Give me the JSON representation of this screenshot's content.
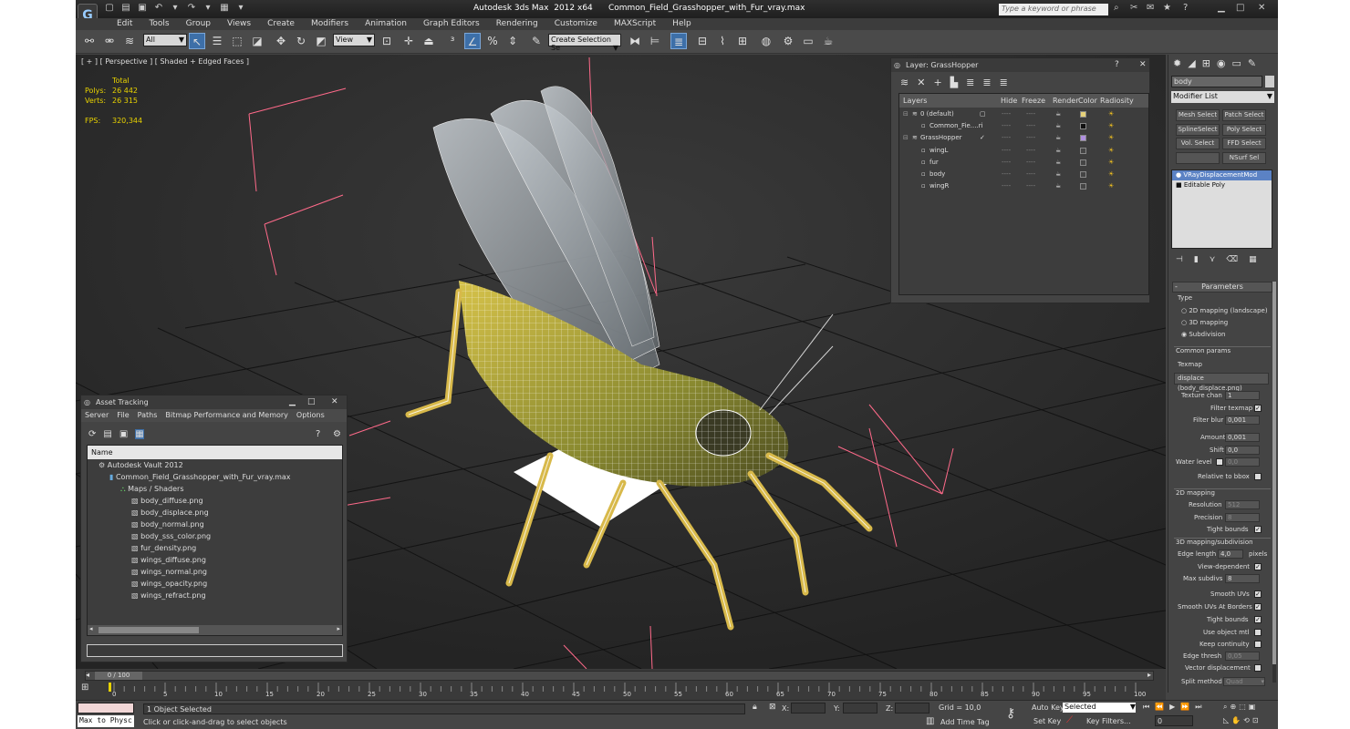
{
  "app": {
    "title": "Autodesk 3ds Max  2012 x64",
    "file": "Common_Field_Grasshopper_with_Fur_vray.max",
    "search_placeholder": "Type a keyword or phrase"
  },
  "menu": [
    "Edit",
    "Tools",
    "Group",
    "Views",
    "Create",
    "Modifiers",
    "Animation",
    "Graph Editors",
    "Rendering",
    "Customize",
    "MAXScript",
    "Help"
  ],
  "toolbar": {
    "selection_filter": "All",
    "ref_coord": "View",
    "named_selection": "Create Selection Se"
  },
  "viewport": {
    "label": "[ + ] [ Perspective ] [ Shaded + Edged Faces ]",
    "stats": {
      "header": "Total",
      "polys_label": "Polys:",
      "polys": "26 442",
      "verts_label": "Verts:",
      "verts": "26 315",
      "fps_label": "FPS:",
      "fps": "320,344"
    }
  },
  "layer_panel": {
    "title": "Layer: GrassHopper",
    "columns": [
      "Layers",
      "Hide",
      "Freeze",
      "Render",
      "Color",
      "Radiosity"
    ],
    "rows": [
      {
        "name": "0 (default)",
        "indent": 0,
        "color": "#e6d27a",
        "mark": "box"
      },
      {
        "name": "Common_Fie....ri",
        "indent": 1,
        "color": "#111111",
        "mark": ""
      },
      {
        "name": "GrassHopper",
        "indent": 0,
        "color": "#b090e0",
        "mark": "check"
      },
      {
        "name": "wingL",
        "indent": 1,
        "color": "#444444",
        "mark": ""
      },
      {
        "name": "fur",
        "indent": 1,
        "color": "#444444",
        "mark": ""
      },
      {
        "name": "body",
        "indent": 1,
        "color": "#444444",
        "mark": ""
      },
      {
        "name": "wingR",
        "indent": 1,
        "color": "#444444",
        "mark": ""
      }
    ],
    "hide_text": "----"
  },
  "asset_panel": {
    "title": "Asset Tracking",
    "menu": [
      "Server",
      "File",
      "Paths",
      "Bitmap Performance and Memory",
      "Options"
    ],
    "column": "Name",
    "tree": [
      {
        "label": "Autodesk Vault 2012",
        "indent": 1
      },
      {
        "label": "Common_Field_Grasshopper_with_Fur_vray.max",
        "indent": 2
      },
      {
        "label": "Maps / Shaders",
        "indent": 3
      },
      {
        "label": "body_diffuse.png",
        "indent": 4
      },
      {
        "label": "body_displace.png",
        "indent": 4
      },
      {
        "label": "body_normal.png",
        "indent": 4
      },
      {
        "label": "body_sss_color.png",
        "indent": 4
      },
      {
        "label": "fur_density.png",
        "indent": 4
      },
      {
        "label": "wings_diffuse.png",
        "indent": 4
      },
      {
        "label": "wings_normal.png",
        "indent": 4
      },
      {
        "label": "wings_opacity.png",
        "indent": 4
      },
      {
        "label": "wings_refract.png",
        "indent": 4
      }
    ]
  },
  "command_panel": {
    "object_name": "body",
    "modifier_list": "Modifier List",
    "buttons": [
      "Mesh Select",
      "Patch Select",
      "SplineSelect",
      "Poly Select",
      "Vol. Select",
      "FFD Select",
      "NSurf Sel"
    ],
    "stack": [
      "VRayDisplacementMod",
      "Editable Poly"
    ],
    "rollout": "Parameters",
    "type_label": "Type",
    "types": [
      "2D mapping (landscape)",
      "3D mapping",
      "Subdivision"
    ],
    "common_params": "Common params",
    "texmap_label": "Texmap",
    "texmap": "displace (body_displace.png)",
    "texture_chan_label": "Texture chan",
    "texture_chan": "1",
    "filter_texmap_label": "Filter texmap",
    "filter_blur_label": "Filter blur",
    "filter_blur": "0,001",
    "amount_label": "Amount",
    "amount": "0,001",
    "shift_label": "Shift",
    "shift": "0,0",
    "water_level_label": "Water level",
    "water_level": "0,0",
    "relative_bbox_label": "Relative to bbox",
    "mapping2d": "2D mapping",
    "resolution_label": "Resolution",
    "resolution": "512",
    "precision_label": "Precision",
    "precision": "8",
    "tight_bounds_label": "Tight bounds",
    "mapping3d": "3D mapping/subdivision",
    "edge_length_label": "Edge length",
    "edge_length": "4,0",
    "pixels": "pixels",
    "view_dependent_label": "View-dependent",
    "max_subdivs_label": "Max subdivs",
    "max_subdivs": "8",
    "smooth_uvs_label": "Smooth UVs",
    "smooth_uvs_borders_label": "Smooth UVs At Borders",
    "tight_bounds2_label": "Tight bounds",
    "use_object_mtl_label": "Use object mtl",
    "keep_continuity_label": "Keep continuity",
    "edge_thresh_label": "Edge thresh",
    "edge_thresh": "0,05",
    "vector_disp_label": "Vector displacement",
    "split_method_label": "Split method",
    "split_method": "Quad"
  },
  "timeline": {
    "frame": "0 / 100",
    "ticks": [
      "0",
      "5",
      "10",
      "15",
      "20",
      "25",
      "30",
      "35",
      "40",
      "45",
      "50",
      "55",
      "60",
      "65",
      "70",
      "75",
      "80",
      "85",
      "90",
      "95",
      "100"
    ]
  },
  "status": {
    "maxscript": "Max to Physc",
    "selected": "1 Object Selected",
    "prompt": "Click or click-and-drag to select objects",
    "x_label": "X:",
    "y_label": "Y:",
    "z_label": "Z:",
    "grid": "Grid = 10,0",
    "add_time_tag": "Add Time Tag",
    "auto_key": "Auto Key",
    "set_key": "Set Key",
    "key_mode": "Selected",
    "key_filters": "Key Filters...",
    "frame": "0"
  }
}
